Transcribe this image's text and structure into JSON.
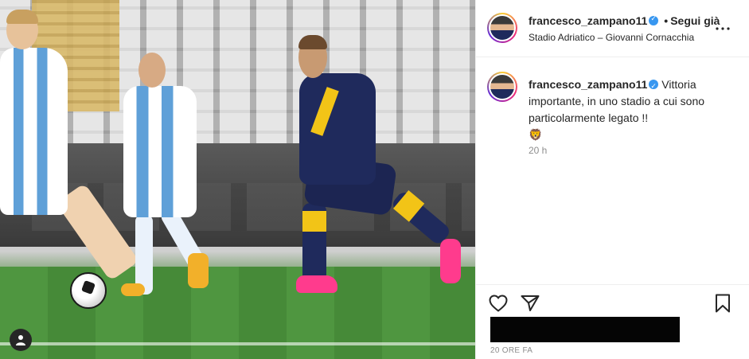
{
  "header": {
    "username": "francesco_zampano11",
    "separator": "•",
    "follow_label": "Segui già",
    "location": "Stadio Adriatico – Giovanni Cornacchia"
  },
  "caption": {
    "username": "francesco_zampano11",
    "text": "Vittoria importante, in uno stadio a cui sono particolarmente legato !!",
    "emoji": "🦁",
    "time": "20 h"
  },
  "actions": {
    "like_icon": "heart-icon",
    "share_icon": "paper-plane-icon",
    "save_icon": "bookmark-icon"
  },
  "footer": {
    "date": "20 ORE FA"
  },
  "colors": {
    "verified": "#3897f0",
    "text_primary": "#262626",
    "text_secondary": "#8e8e8e"
  }
}
